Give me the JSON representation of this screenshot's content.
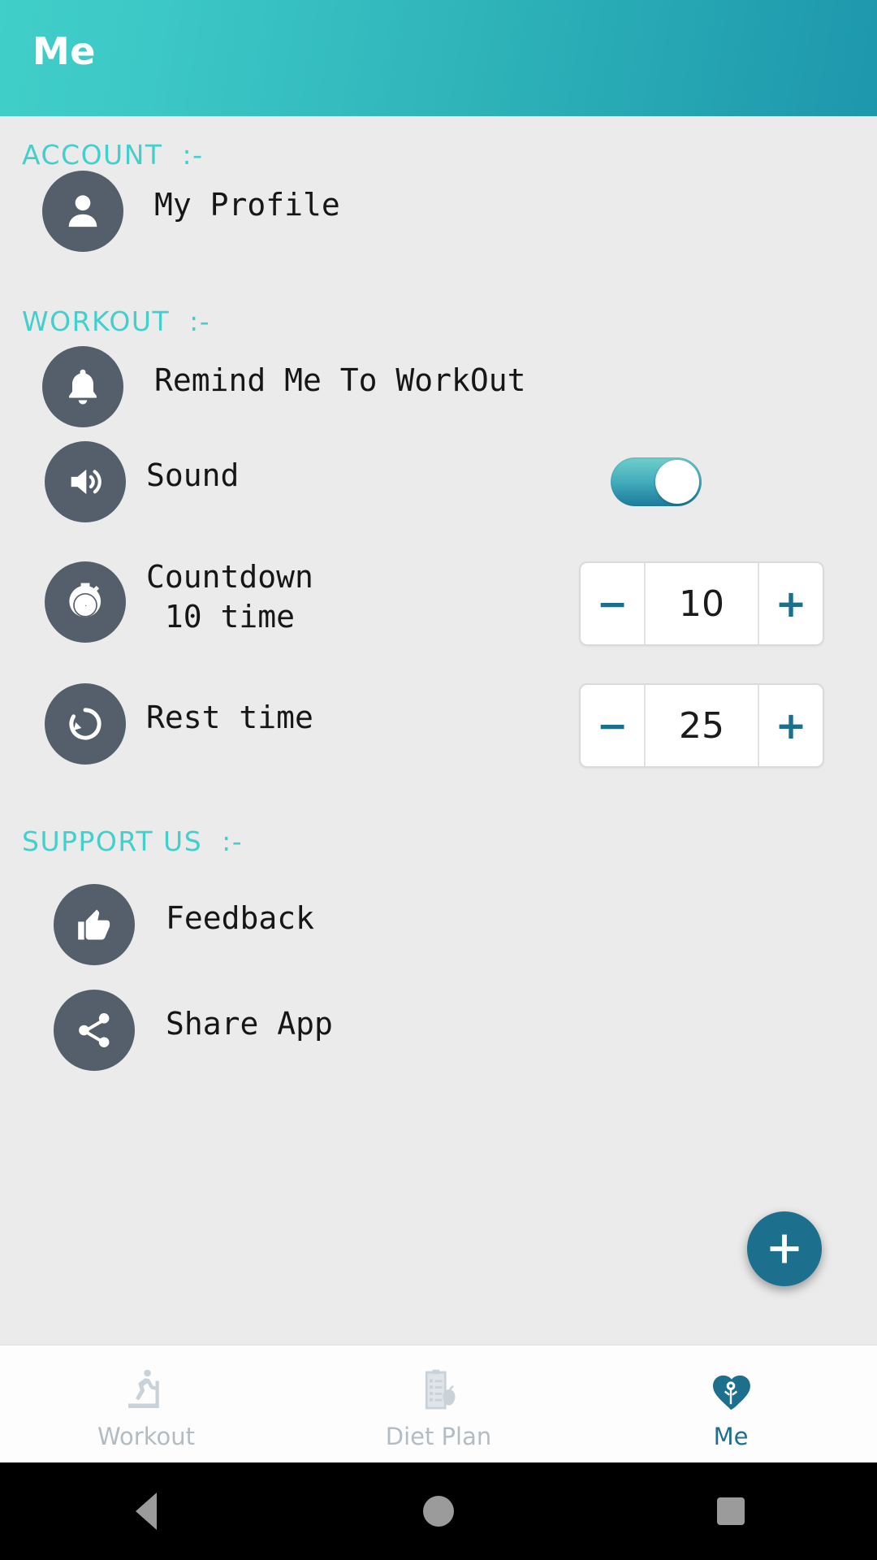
{
  "appbar": {
    "title": "Me"
  },
  "sections": {
    "account": {
      "header": "ACCOUNT  :-"
    },
    "workout": {
      "header": "WORKOUT  :-"
    },
    "support": {
      "header": "SUPPORT US  :-"
    }
  },
  "rows": {
    "profile": {
      "label": "My Profile",
      "icon": "person-icon"
    },
    "remind": {
      "label": "Remind Me To WorkOut",
      "icon": "bell-icon"
    },
    "sound": {
      "label": "Sound",
      "icon": "speaker-icon",
      "toggle_state": "on"
    },
    "countdown": {
      "label_line1": "Countdown",
      "label_line2": " 10 time",
      "icon": "stopwatch-icon",
      "value": "10",
      "minus": "−",
      "plus": "+"
    },
    "rest": {
      "label": "Rest time",
      "icon": "restore-icon",
      "value": "25",
      "minus": "−",
      "plus": "+"
    },
    "feedback": {
      "label": "Feedback",
      "icon": "thumbs-up-icon"
    },
    "share": {
      "label": "Share App",
      "icon": "share-icon"
    }
  },
  "fab": {
    "icon": "plus-icon"
  },
  "tabbar": {
    "tabs": [
      {
        "label": "Workout",
        "icon": "treadmill-icon",
        "active": false
      },
      {
        "label": "Diet Plan",
        "icon": "clipboard-apple-icon",
        "active": false
      },
      {
        "label": "Me",
        "icon": "heart-person-icon",
        "active": true
      }
    ]
  },
  "colors": {
    "appbar_gradient_start": "#41cfc9",
    "appbar_gradient_end": "#1d97ac",
    "section_header": "#43cfcb",
    "icon_circle": "#555f6b",
    "accent_blue": "#1d6f8e",
    "page_background": "#ebebeb",
    "tab_inactive": "#b3bcc2"
  }
}
